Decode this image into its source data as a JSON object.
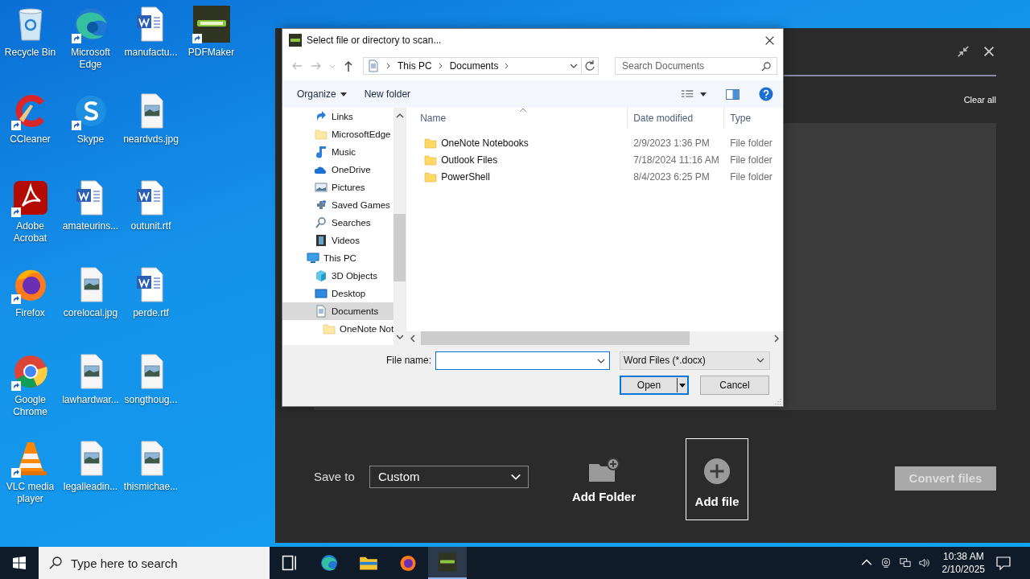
{
  "desktop_icons": [
    {
      "label": "Recycle Bin",
      "kind": "recycle",
      "shortcut": false
    },
    {
      "label": "CCleaner",
      "kind": "ccleaner",
      "shortcut": true
    },
    {
      "label": "Adobe Acrobat",
      "kind": "acrobat",
      "shortcut": true
    },
    {
      "label": "Firefox",
      "kind": "firefox",
      "shortcut": true
    },
    {
      "label": "Google Chrome",
      "kind": "chrome",
      "shortcut": true
    },
    {
      "label": "VLC media player",
      "kind": "vlc",
      "shortcut": true
    },
    {
      "label": "Microsoft Edge",
      "kind": "edge",
      "shortcut": true
    },
    {
      "label": "Skype",
      "kind": "skype",
      "shortcut": true
    },
    {
      "label": "amateurins...",
      "kind": "word",
      "shortcut": false
    },
    {
      "label": "corelocal.jpg",
      "kind": "image",
      "shortcut": false
    },
    {
      "label": "lawhardwar...",
      "kind": "image",
      "shortcut": false
    },
    {
      "label": "legalleadin...",
      "kind": "image",
      "shortcut": false
    },
    {
      "label": "manufactu...",
      "kind": "word",
      "shortcut": false
    },
    {
      "label": "neardvds.jpg",
      "kind": "image",
      "shortcut": false
    },
    {
      "label": "outunit.rtf",
      "kind": "word",
      "shortcut": false
    },
    {
      "label": "perde.rtf",
      "kind": "word",
      "shortcut": false
    },
    {
      "label": "songthoug...",
      "kind": "image",
      "shortcut": false
    },
    {
      "label": "thismichae...",
      "kind": "image",
      "shortcut": false
    },
    {
      "label": "PDFMaker",
      "kind": "pdfmaker",
      "shortcut": true
    }
  ],
  "app_window": {
    "clear_all": "Clear all",
    "save_to_label": "Save to",
    "save_to_value": "Custom",
    "add_folder": "Add Folder",
    "add_file": "Add file",
    "convert_button": {
      "label": "Convert files",
      "disabled": true
    }
  },
  "dialog": {
    "title": "Select file or directory to scan...",
    "breadcrumb": [
      "This PC",
      "Documents"
    ],
    "search": {
      "placeholder": "Search Documents"
    },
    "toolbar": {
      "organize": "Organize",
      "new_folder": "New folder"
    },
    "navigation": {
      "scrolled_items": [
        {
          "label": "Links",
          "kind": "links",
          "selected": false
        },
        {
          "label": "MicrosoftEdge",
          "kind": "folder",
          "selected": false
        },
        {
          "label": "Music",
          "kind": "music",
          "selected": false
        },
        {
          "label": "OneDrive",
          "kind": "onedrive",
          "selected": false
        },
        {
          "label": "Pictures",
          "kind": "pictures",
          "selected": false
        },
        {
          "label": "Saved Games",
          "kind": "games",
          "selected": false
        },
        {
          "label": "Searches",
          "kind": "search",
          "selected": false
        },
        {
          "label": "Videos",
          "kind": "videos",
          "selected": false
        }
      ],
      "tree": [
        {
          "label": "This PC",
          "kind": "pc",
          "selected": false,
          "children": [
            {
              "label": "3D Objects",
              "kind": "objects3d",
              "selected": false
            },
            {
              "label": "Desktop",
              "kind": "desktop",
              "selected": false
            },
            {
              "label": "Documents",
              "kind": "documents",
              "selected": true,
              "children": [
                {
                  "label": "OneNote Not",
                  "kind": "folder",
                  "selected": false
                }
              ]
            }
          ]
        }
      ]
    },
    "columns": [
      "Name",
      "Date modified",
      "Type"
    ],
    "rows": [
      {
        "name": "OneNote Notebooks",
        "date_modified": "2/9/2023 1:36 PM",
        "type": "File folder"
      },
      {
        "name": "Outlook Files",
        "date_modified": "7/18/2024 11:16 AM",
        "type": "File folder"
      },
      {
        "name": "PowerShell",
        "date_modified": "8/4/2023 6:25 PM",
        "type": "File folder"
      }
    ],
    "file_name_label": "File name:",
    "file_type": "Word Files (*.docx)",
    "buttons": [
      {
        "label": "Open",
        "default": true
      },
      {
        "label": "Cancel",
        "default": false
      }
    ]
  },
  "taskbar": {
    "search": {
      "placeholder": "Type here to search"
    },
    "apps": [
      {
        "kind": "taskview",
        "selected": false
      },
      {
        "kind": "edge",
        "selected": false
      },
      {
        "kind": "explorer",
        "selected": false
      },
      {
        "kind": "firefox",
        "selected": false
      },
      {
        "kind": "pdfmaker",
        "selected": true
      }
    ],
    "time": "10:38 AM",
    "date": "2/10/2025"
  }
}
